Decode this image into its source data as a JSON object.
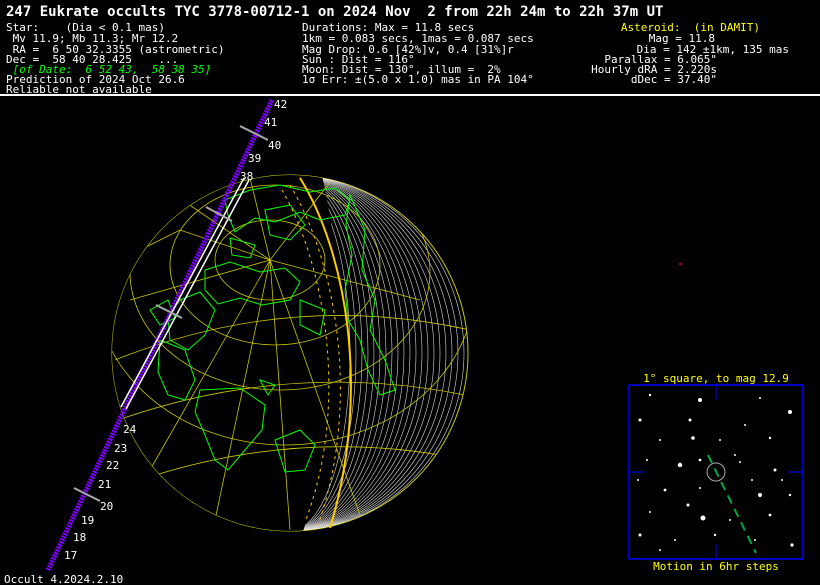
{
  "title": "247 Eukrate occults TYC 3778-00712-1 on 2024 Nov  2 from 22h 24m to 22h 37m UT",
  "star": {
    "line1": "Star:    (Dia < 0.1 mas)",
    "line2": " Mv 11.9; Mb 11.3; Mr 12.2",
    "line3": " RA =  6 50 32.3355 (astrometric)",
    "line4": "Dec =  58 40 28.425    ...",
    "line5": " [of Date:  6 52 43,  58 38 35]",
    "line6": "Prediction of 2024 Oct 26.6",
    "line7": "Reliable not available"
  },
  "event": {
    "line1": "Durations: Max = 11.8 secs",
    "line2": "1km = 0.083 secs, 1mas = 0.087 secs",
    "line3": "Mag Drop: 0.6 [42%]v, 0.4 [31%]r",
    "line4": "Sun : Dist = 116°",
    "line5": "Moon: Dist = 130°, illum =  2%",
    "line6": "1σ Err: ±(5.0 x 1.0) mas in PA 104°"
  },
  "asteroid": {
    "header": "Asteroid:  (in DAMIT)",
    "line1": "Mag = 11.8",
    "line2": "Dia = 142 ±1km, 135 mas",
    "line3": "Parallax = 6.065\"",
    "line4": "Hourly dRA = 2.220s",
    "line5": "dDec = 37.40\""
  },
  "path_ticks_upper": [
    "42",
    "41",
    "40",
    "39",
    "38"
  ],
  "path_ticks_lower": [
    "24",
    "23",
    "22",
    "21",
    "20",
    "19",
    "18",
    "17"
  ],
  "star_chart": {
    "caption": "1° square, to mag 12.9",
    "footer": "Motion in 6hr steps"
  },
  "version": "Occult 4.2024.2.10",
  "colors": {
    "land": "#00ff00",
    "grid": "#c8c800",
    "limb": "#ffff00",
    "path": "#ffffff",
    "path_ticks": "#8000ff",
    "chart_box": "#0000ff",
    "caption": "#ffff00"
  }
}
